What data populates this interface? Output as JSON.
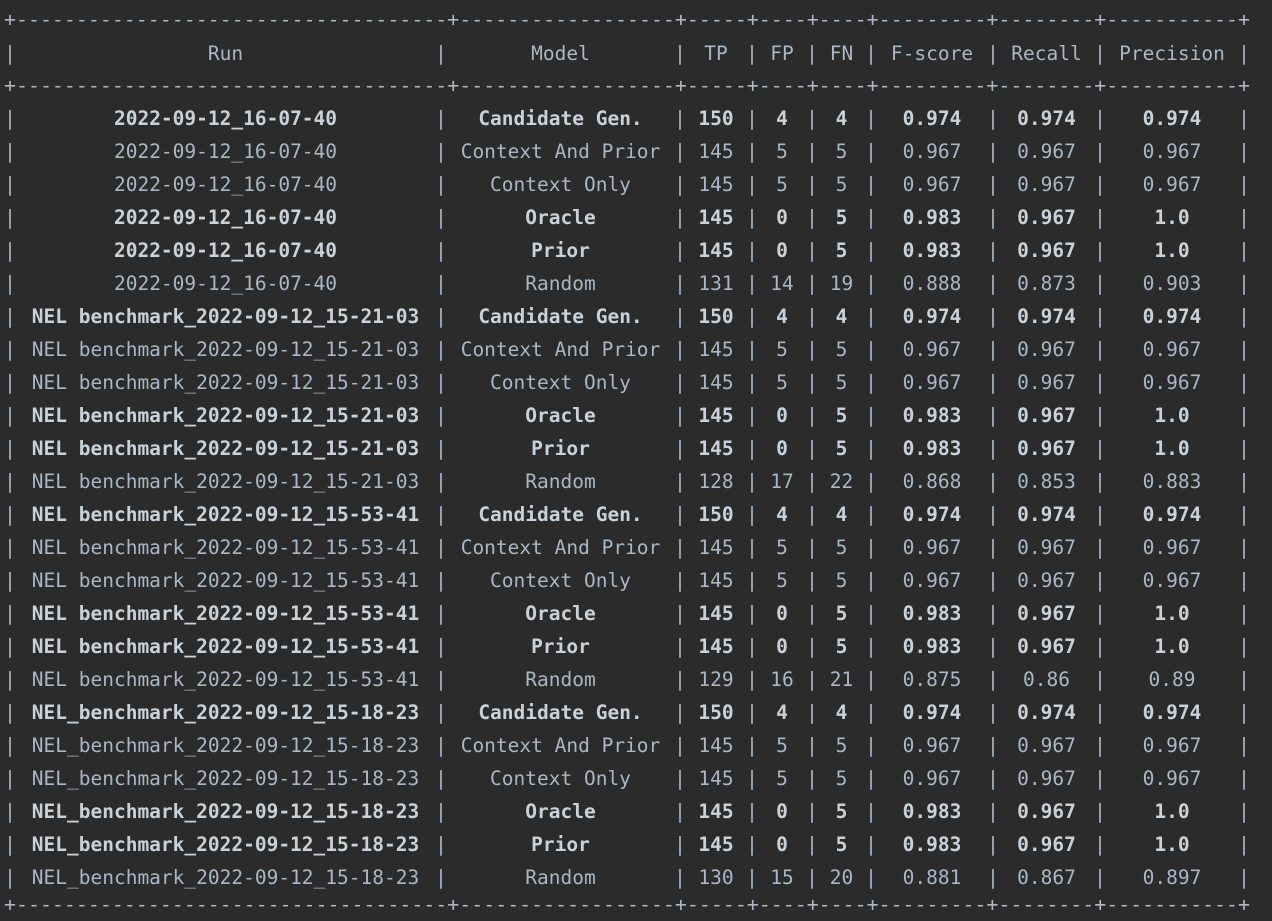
{
  "table": {
    "separator": "+------------------------------------+------------------+-----+----+----+---------+--------+-----------+",
    "headers": [
      "Run",
      "Model",
      "TP",
      "FP",
      "FN",
      "F-score",
      "Recall",
      "Precision"
    ],
    "rows": [
      {
        "bold": true,
        "cells": [
          "2022-09-12_16-07-40",
          "Candidate Gen.",
          "150",
          "4",
          "4",
          "0.974",
          "0.974",
          "0.974"
        ]
      },
      {
        "bold": false,
        "cells": [
          "2022-09-12_16-07-40",
          "Context And Prior",
          "145",
          "5",
          "5",
          "0.967",
          "0.967",
          "0.967"
        ]
      },
      {
        "bold": false,
        "cells": [
          "2022-09-12_16-07-40",
          "Context Only",
          "145",
          "5",
          "5",
          "0.967",
          "0.967",
          "0.967"
        ]
      },
      {
        "bold": true,
        "cells": [
          "2022-09-12_16-07-40",
          "Oracle",
          "145",
          "0",
          "5",
          "0.983",
          "0.967",
          "1.0"
        ]
      },
      {
        "bold": true,
        "cells": [
          "2022-09-12_16-07-40",
          "Prior",
          "145",
          "0",
          "5",
          "0.983",
          "0.967",
          "1.0"
        ]
      },
      {
        "bold": false,
        "cells": [
          "2022-09-12_16-07-40",
          "Random",
          "131",
          "14",
          "19",
          "0.888",
          "0.873",
          "0.903"
        ]
      },
      {
        "bold": true,
        "cells": [
          "NEL benchmark_2022-09-12_15-21-03",
          "Candidate Gen.",
          "150",
          "4",
          "4",
          "0.974",
          "0.974",
          "0.974"
        ]
      },
      {
        "bold": false,
        "cells": [
          "NEL benchmark_2022-09-12_15-21-03",
          "Context And Prior",
          "145",
          "5",
          "5",
          "0.967",
          "0.967",
          "0.967"
        ]
      },
      {
        "bold": false,
        "cells": [
          "NEL benchmark_2022-09-12_15-21-03",
          "Context Only",
          "145",
          "5",
          "5",
          "0.967",
          "0.967",
          "0.967"
        ]
      },
      {
        "bold": true,
        "cells": [
          "NEL benchmark_2022-09-12_15-21-03",
          "Oracle",
          "145",
          "0",
          "5",
          "0.983",
          "0.967",
          "1.0"
        ]
      },
      {
        "bold": true,
        "cells": [
          "NEL benchmark_2022-09-12_15-21-03",
          "Prior",
          "145",
          "0",
          "5",
          "0.983",
          "0.967",
          "1.0"
        ]
      },
      {
        "bold": false,
        "cells": [
          "NEL benchmark_2022-09-12_15-21-03",
          "Random",
          "128",
          "17",
          "22",
          "0.868",
          "0.853",
          "0.883"
        ]
      },
      {
        "bold": true,
        "cells": [
          "NEL benchmark_2022-09-12_15-53-41",
          "Candidate Gen.",
          "150",
          "4",
          "4",
          "0.974",
          "0.974",
          "0.974"
        ]
      },
      {
        "bold": false,
        "cells": [
          "NEL benchmark_2022-09-12_15-53-41",
          "Context And Prior",
          "145",
          "5",
          "5",
          "0.967",
          "0.967",
          "0.967"
        ]
      },
      {
        "bold": false,
        "cells": [
          "NEL benchmark_2022-09-12_15-53-41",
          "Context Only",
          "145",
          "5",
          "5",
          "0.967",
          "0.967",
          "0.967"
        ]
      },
      {
        "bold": true,
        "cells": [
          "NEL benchmark_2022-09-12_15-53-41",
          "Oracle",
          "145",
          "0",
          "5",
          "0.983",
          "0.967",
          "1.0"
        ]
      },
      {
        "bold": true,
        "cells": [
          "NEL benchmark_2022-09-12_15-53-41",
          "Prior",
          "145",
          "0",
          "5",
          "0.983",
          "0.967",
          "1.0"
        ]
      },
      {
        "bold": false,
        "cells": [
          "NEL benchmark_2022-09-12_15-53-41",
          "Random",
          "129",
          "16",
          "21",
          "0.875",
          "0.86",
          "0.89"
        ]
      },
      {
        "bold": true,
        "cells": [
          "NEL_benchmark_2022-09-12_15-18-23",
          "Candidate Gen.",
          "150",
          "4",
          "4",
          "0.974",
          "0.974",
          "0.974"
        ]
      },
      {
        "bold": false,
        "cells": [
          "NEL_benchmark_2022-09-12_15-18-23",
          "Context And Prior",
          "145",
          "5",
          "5",
          "0.967",
          "0.967",
          "0.967"
        ]
      },
      {
        "bold": false,
        "cells": [
          "NEL_benchmark_2022-09-12_15-18-23",
          "Context Only",
          "145",
          "5",
          "5",
          "0.967",
          "0.967",
          "0.967"
        ]
      },
      {
        "bold": true,
        "cells": [
          "NEL_benchmark_2022-09-12_15-18-23",
          "Oracle",
          "145",
          "0",
          "5",
          "0.983",
          "0.967",
          "1.0"
        ]
      },
      {
        "bold": true,
        "cells": [
          "NEL_benchmark_2022-09-12_15-18-23",
          "Prior",
          "145",
          "0",
          "5",
          "0.983",
          "0.967",
          "1.0"
        ]
      },
      {
        "bold": false,
        "cells": [
          "NEL_benchmark_2022-09-12_15-18-23",
          "Random",
          "130",
          "15",
          "20",
          "0.881",
          "0.867",
          "0.897"
        ]
      }
    ]
  },
  "colors": {
    "background": "#2b2b2b",
    "text": "#a9b7c6",
    "bold_text": "#c9d1d9"
  }
}
